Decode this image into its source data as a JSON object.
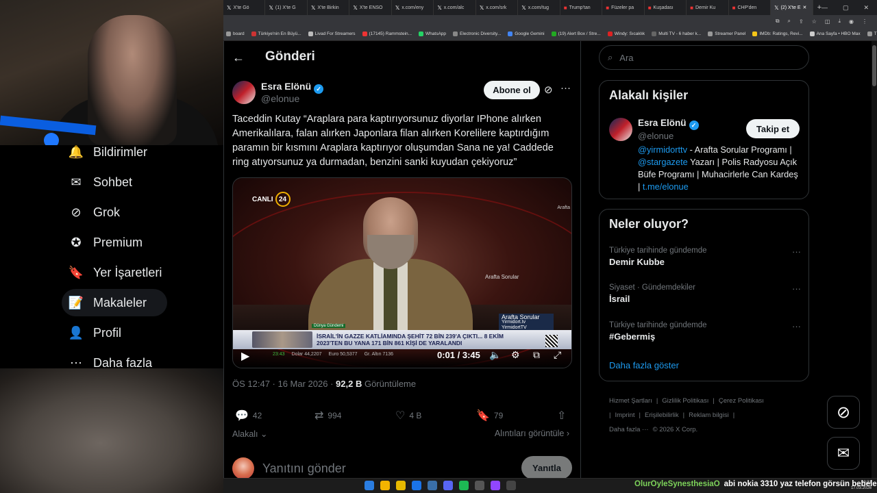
{
  "browser": {
    "tabs": [
      {
        "label": "X'te Gö"
      },
      {
        "label": "(1) X'te G"
      },
      {
        "label": "X'te Birkin"
      },
      {
        "label": "X'te ENSO"
      },
      {
        "label": "x.com/eny"
      },
      {
        "label": "x.com/alc"
      },
      {
        "label": "x.com/srk"
      },
      {
        "label": "x.com/tug"
      },
      {
        "label": "Trump'tan"
      },
      {
        "label": "Füzeler pa"
      },
      {
        "label": "Kuşadası"
      },
      {
        "label": "Demir Ku"
      },
      {
        "label": "CHP'den"
      },
      {
        "label": "(2) X'te E"
      }
    ],
    "bookmarks": [
      {
        "label": "board"
      },
      {
        "label": "Türkiye'nin En Büyü..."
      },
      {
        "label": "Livad For Streamers"
      },
      {
        "label": "(17145) Rammstein..."
      },
      {
        "label": "WhatsApp"
      },
      {
        "label": "Electronic Diversity..."
      },
      {
        "label": "Google Gemini"
      },
      {
        "label": "(19) Alert Box / Stre..."
      },
      {
        "label": "Windy: Sıcaklık"
      },
      {
        "label": "Multi TV - 6 haber k..."
      },
      {
        "label": "Streamer Panel"
      },
      {
        "label": "IMDb: Ratings, Revi..."
      },
      {
        "label": "Ana Sayfa • HBO Max"
      },
      {
        "label": "Tüm Yer İşaretleri"
      }
    ],
    "bookmark_colors": [
      "#999",
      "#c33",
      "#bbb",
      "#e33",
      "#25d366",
      "#888",
      "#4285f4",
      "#2a2",
      "#d22",
      "#666",
      "#999",
      "#f5c518",
      "#ccc",
      "#999"
    ]
  },
  "nav": {
    "items": [
      {
        "label": "Bildirimler",
        "icon": "bell-icon",
        "glyph": "🔔"
      },
      {
        "label": "Sohbet",
        "icon": "mail-icon",
        "glyph": "✉"
      },
      {
        "label": "Grok",
        "icon": "grok-icon",
        "glyph": "⊘"
      },
      {
        "label": "Premium",
        "icon": "premium-icon",
        "glyph": "✪"
      },
      {
        "label": "Yer İşaretleri",
        "icon": "bookmark-icon",
        "glyph": "🔖"
      },
      {
        "label": "Makaleler",
        "icon": "article-icon",
        "glyph": "📝"
      },
      {
        "label": "Profil",
        "icon": "profile-icon",
        "glyph": "👤"
      },
      {
        "label": "Daha fazla",
        "icon": "more-circle-icon",
        "glyph": "⋯"
      }
    ]
  },
  "post": {
    "page_title": "Gönderi",
    "author_name": "Esra Elönü",
    "author_handle": "@elonue",
    "follow_label": "Abone ol",
    "text": "Taceddin Kutay “Araplara para kaptırıyorsunuz diyorlar IPhone alırken Amerikalılara, falan alırken Japonlara filan alırken Korelilere kaptırdığım paramın bir kısmını Araplara kaptırıyor oluşumdan  Sana ne ya! Caddede ring atıyorsunuz ya durmadan, benzini sanki kuyudan çekiyoruz”",
    "video": {
      "live_label": "CANLI",
      "channel_num": "24",
      "program_right": "Arafta",
      "program_mid": "Arafta Sorular",
      "program_box_title": "Arafta Sorular",
      "program_box_sub1": "Yirmidort.tv",
      "program_box_sub2": "YirmidortTV",
      "category": "Dünya Gündemi",
      "ticker": "İSRAİL'İN GAZZE KATLİAMINDA ŞEHİT 72 BİN 239'A ÇIKTI... 8 EKİM 2023'TEN BU YANA 171 BİN 861 KİŞİ DE YARALANDI",
      "clock": "23:43",
      "market_1": "Dolar  44,2207",
      "market_2": "Euro  50,5377",
      "market_3": "Gr. Altın  7136",
      "time_display": "0:01 / 3:45"
    },
    "timestamp": "ÖS 12:47 · 16 Mar 2026 · ",
    "views_value": "92,2 B",
    "views_label": " Görüntüleme",
    "replies": "42",
    "reposts": "994",
    "likes": "4 B",
    "bookmarks": "79",
    "related_label": "Alakalı",
    "quotes_label": "Alıntıları görüntüle",
    "reply_placeholder": "Yanıtını gönder",
    "reply_button": "Yanıtla"
  },
  "sidebar": {
    "search_placeholder": "Ara",
    "related_title": "Alakalı kişiler",
    "related_name": "Esra Elönü",
    "related_handle": "@elonue",
    "related_follow": "Takip et",
    "bio_link1": "@yirmidorttv",
    "bio_part1": " - Arafta Sorular Programı | ",
    "bio_link2": "@stargazete",
    "bio_part2": " Yazarı | Polis Radyosu Açık Büfe Programı | Muhacirlerle Can Kardeş | ",
    "bio_link3": "t.me/elonue",
    "trends_title": "Neler oluyor?",
    "trends": [
      {
        "context": "Türkiye tarihinde gündemde",
        "name": "Demir Kubbe"
      },
      {
        "context": "Siyaset · Gündemdekiler",
        "name": "İsrail"
      },
      {
        "context": "Türkiye tarihinde gündemde",
        "name": "#Gebermiş"
      }
    ],
    "show_more": "Daha fazla göster",
    "footer": [
      "Hizmet Şartları",
      "|",
      "Gizlilik Politikası",
      "|",
      "Çerez Politikası",
      "|",
      "Imprint",
      "|",
      "Erişilebilirlik",
      "|",
      "Reklam bilgisi",
      "|",
      "Daha fazla ···",
      "© 2026 X Corp."
    ]
  },
  "taskbar": {
    "chat_user": "OlurOyleSynesthesiaO",
    "chat_message": "abi nokia 3310 yaz telefon görsün bebeler",
    "time": "09:31",
    "date": "17.03.2026"
  },
  "colors": {
    "accent": "#1d9bf0",
    "background": "#000000",
    "text": "#e7e9ea",
    "muted": "#71767b"
  }
}
